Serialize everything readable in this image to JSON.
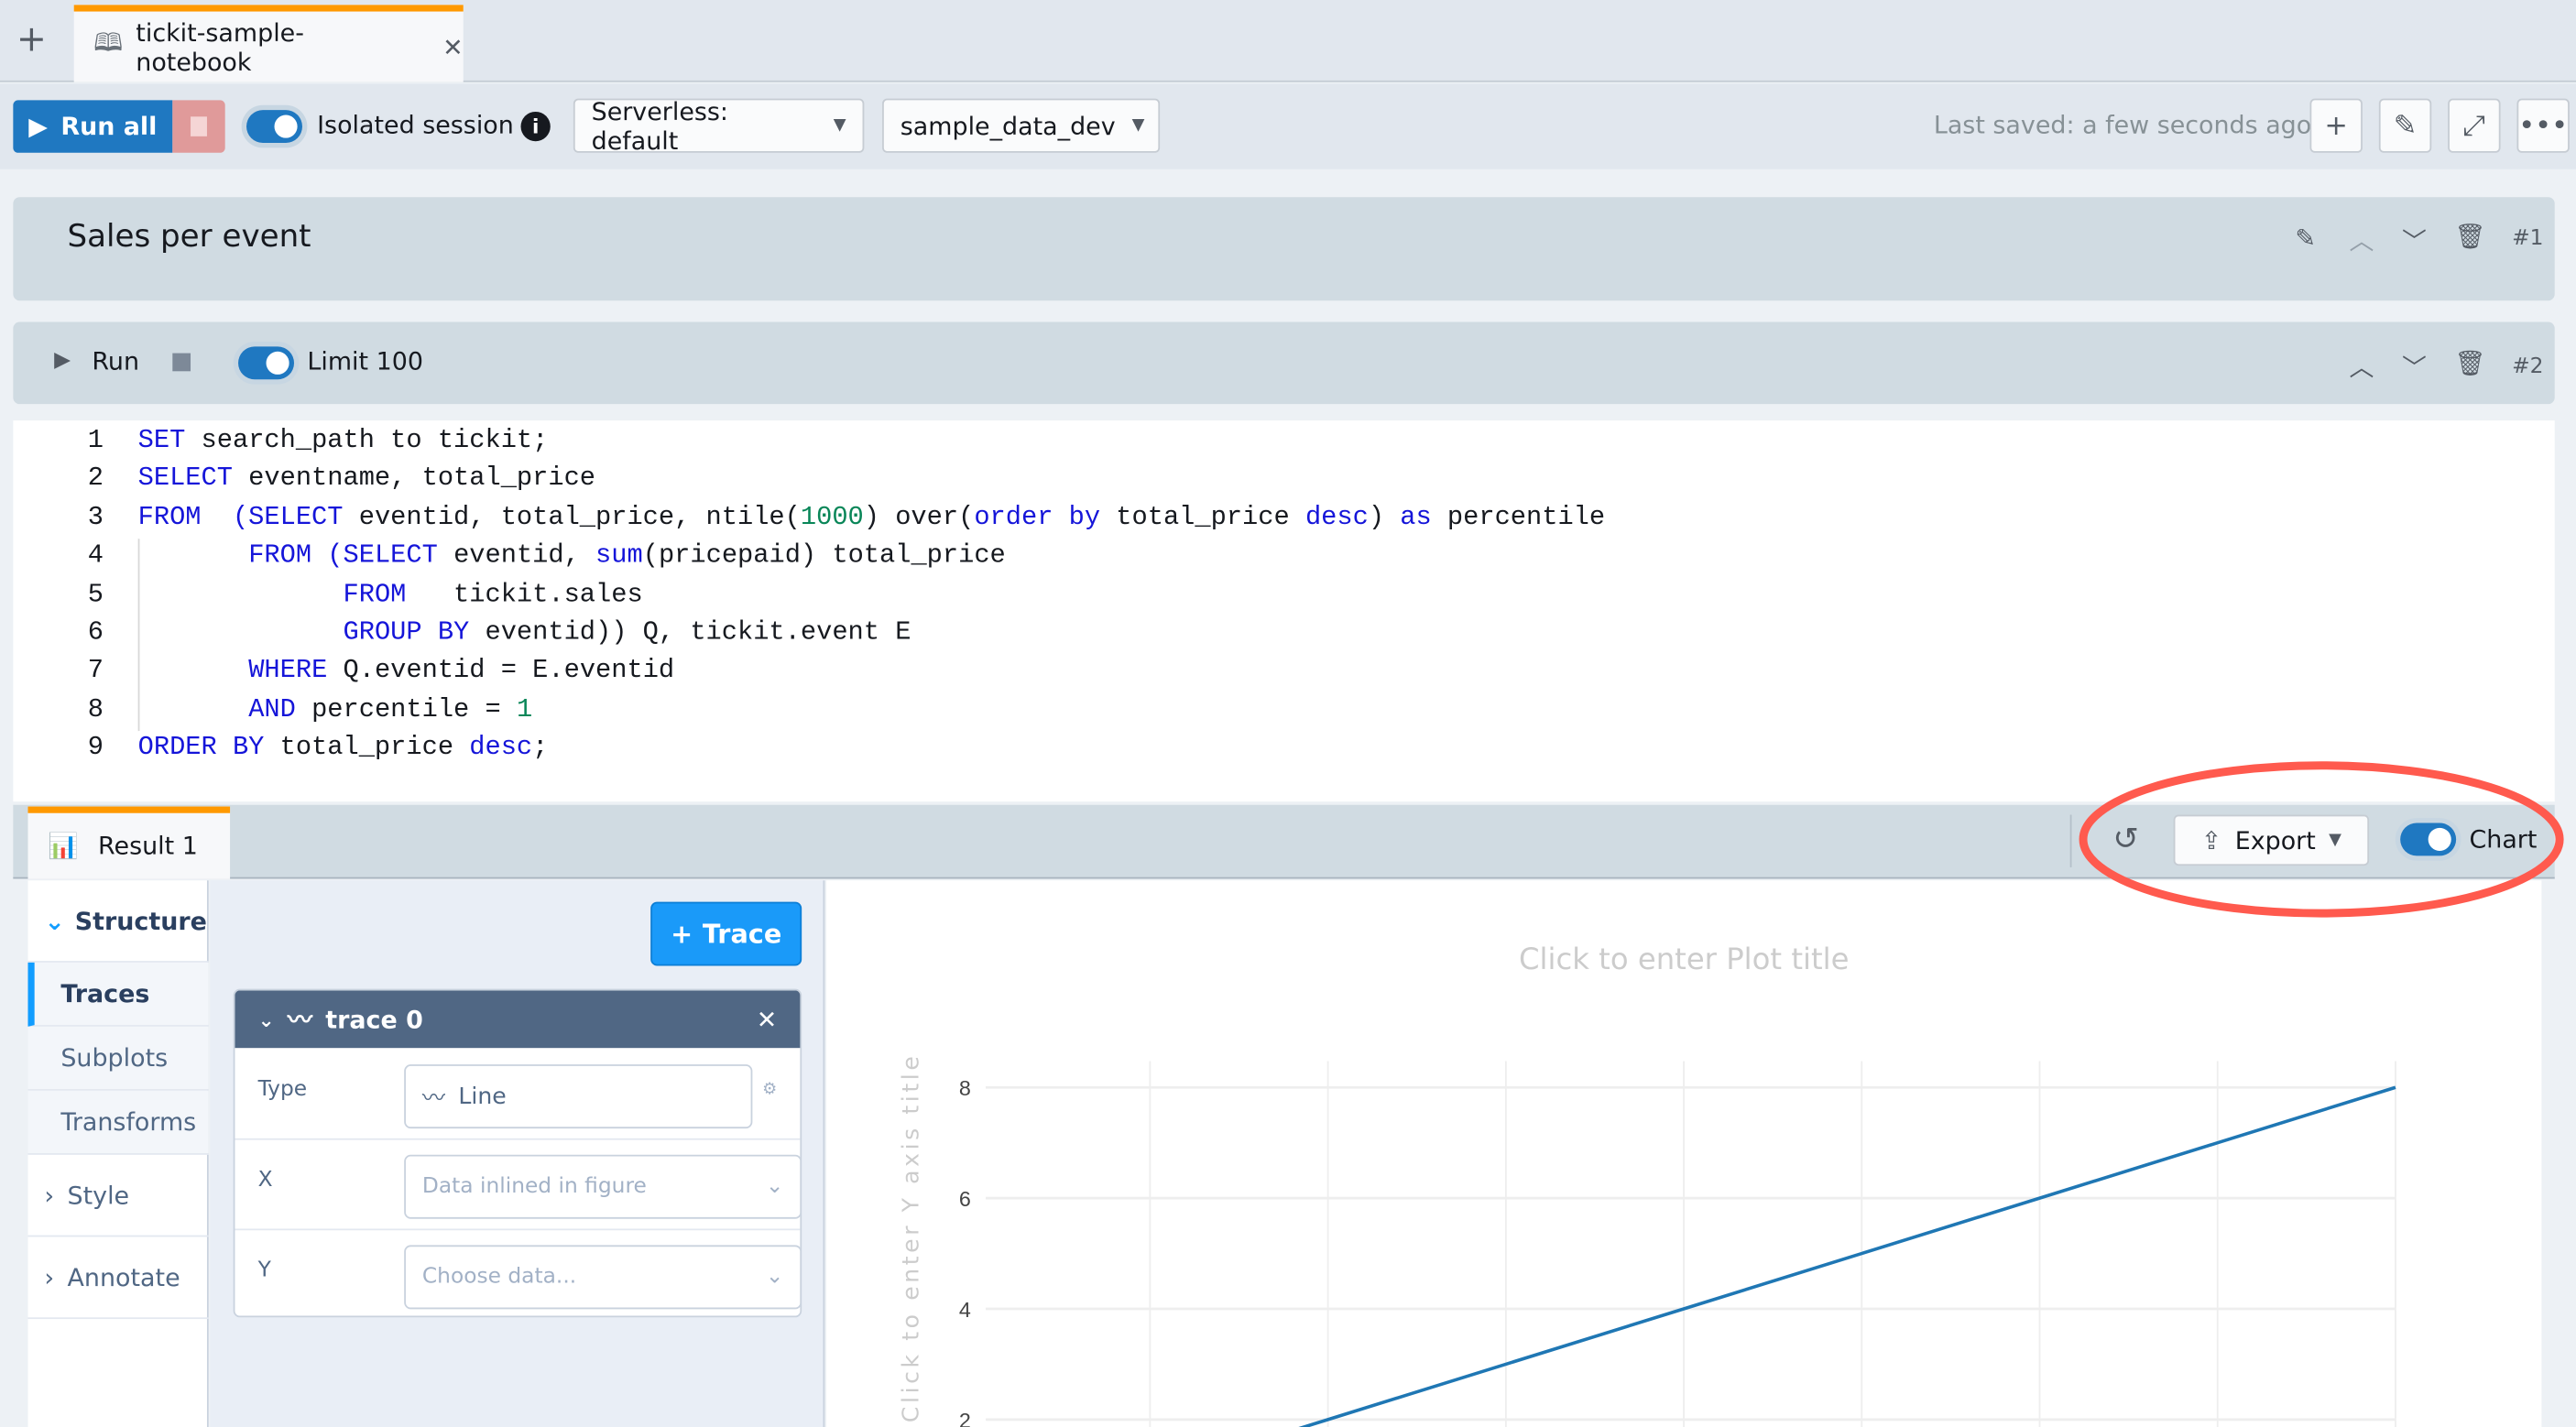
{
  "tab": {
    "title": "tickit-sample-notebook"
  },
  "toolbar": {
    "run_all": "Run all",
    "isolated_session": "Isolated session",
    "compute": "Serverless: default",
    "database": "sample_data_dev",
    "last_saved": "Last saved: a few seconds ago"
  },
  "cell1": {
    "title": "Sales per event",
    "number": "#1"
  },
  "cell2": {
    "run": "Run",
    "limit": "Limit 100",
    "number": "#2"
  },
  "code": {
    "lines": [
      [
        [
          "k",
          "SET"
        ],
        [
          "t",
          " search_path to tickit;"
        ]
      ],
      [
        [
          "k",
          "SELECT"
        ],
        [
          "t",
          " eventname, total_price"
        ]
      ],
      [
        [
          "k",
          "FROM"
        ],
        [
          "t",
          "  "
        ],
        [
          "k",
          "(SELECT"
        ],
        [
          "t",
          " eventid, total_price, ntile("
        ],
        [
          "n",
          "1000"
        ],
        [
          "t",
          ") over("
        ],
        [
          "k",
          "order by"
        ],
        [
          "t",
          " total_price "
        ],
        [
          "k",
          "desc"
        ],
        [
          "t",
          ") "
        ],
        [
          "k",
          "as"
        ],
        [
          "t",
          " percentile"
        ]
      ],
      [
        [
          "t",
          "       "
        ],
        [
          "k",
          "FROM"
        ],
        [
          "t",
          " "
        ],
        [
          "k",
          "(SELECT"
        ],
        [
          "t",
          " eventid, "
        ],
        [
          "k",
          "sum"
        ],
        [
          "t",
          "(pricepaid) total_price"
        ]
      ],
      [
        [
          "t",
          "             "
        ],
        [
          "k",
          "FROM"
        ],
        [
          "t",
          "   tickit.sales"
        ]
      ],
      [
        [
          "t",
          "             "
        ],
        [
          "k",
          "GROUP BY"
        ],
        [
          "t",
          " eventid)) Q, tickit.event E"
        ]
      ],
      [
        [
          "t",
          "       "
        ],
        [
          "k",
          "WHERE"
        ],
        [
          "t",
          " Q.eventid = E.eventid"
        ]
      ],
      [
        [
          "t",
          "       "
        ],
        [
          "k",
          "AND"
        ],
        [
          "t",
          " percentile = "
        ],
        [
          "n",
          "1"
        ]
      ],
      [
        [
          "k",
          "ORDER BY"
        ],
        [
          "t",
          " total_price "
        ],
        [
          "k",
          "desc"
        ],
        [
          "t",
          ";"
        ]
      ]
    ]
  },
  "result": {
    "tab": "Result 1",
    "export": "Export",
    "chart_toggle": "Chart"
  },
  "editor": {
    "nav": {
      "structure": "Structure",
      "traces": "Traces",
      "subplots": "Subplots",
      "transforms": "Transforms",
      "style": "Style",
      "annotate": "Annotate"
    },
    "add_trace": "Trace",
    "trace": {
      "name": "trace 0",
      "type_label": "Type",
      "type_value": "Line",
      "x_label": "X",
      "x_value": "Data inlined in figure",
      "y_label": "Y",
      "y_placeholder": "Choose data..."
    }
  },
  "colors": {
    "accent": "#1f78c1",
    "tab_accent": "#ff9900",
    "line": "#1f77b4",
    "annotation": "#ff5a4e"
  },
  "chart_data": {
    "type": "line",
    "title": "Click to enter Plot title",
    "ylabel": "Click to enter Y axis title",
    "xlabel": "",
    "x": [
      1,
      2,
      3,
      4,
      5,
      6,
      7,
      8
    ],
    "y": [
      1,
      2,
      3,
      4,
      5,
      6,
      7,
      8
    ],
    "yticks": [
      "2",
      "4",
      "6",
      "8"
    ],
    "ytick_values": [
      2,
      4,
      6,
      8
    ],
    "grid": true
  }
}
